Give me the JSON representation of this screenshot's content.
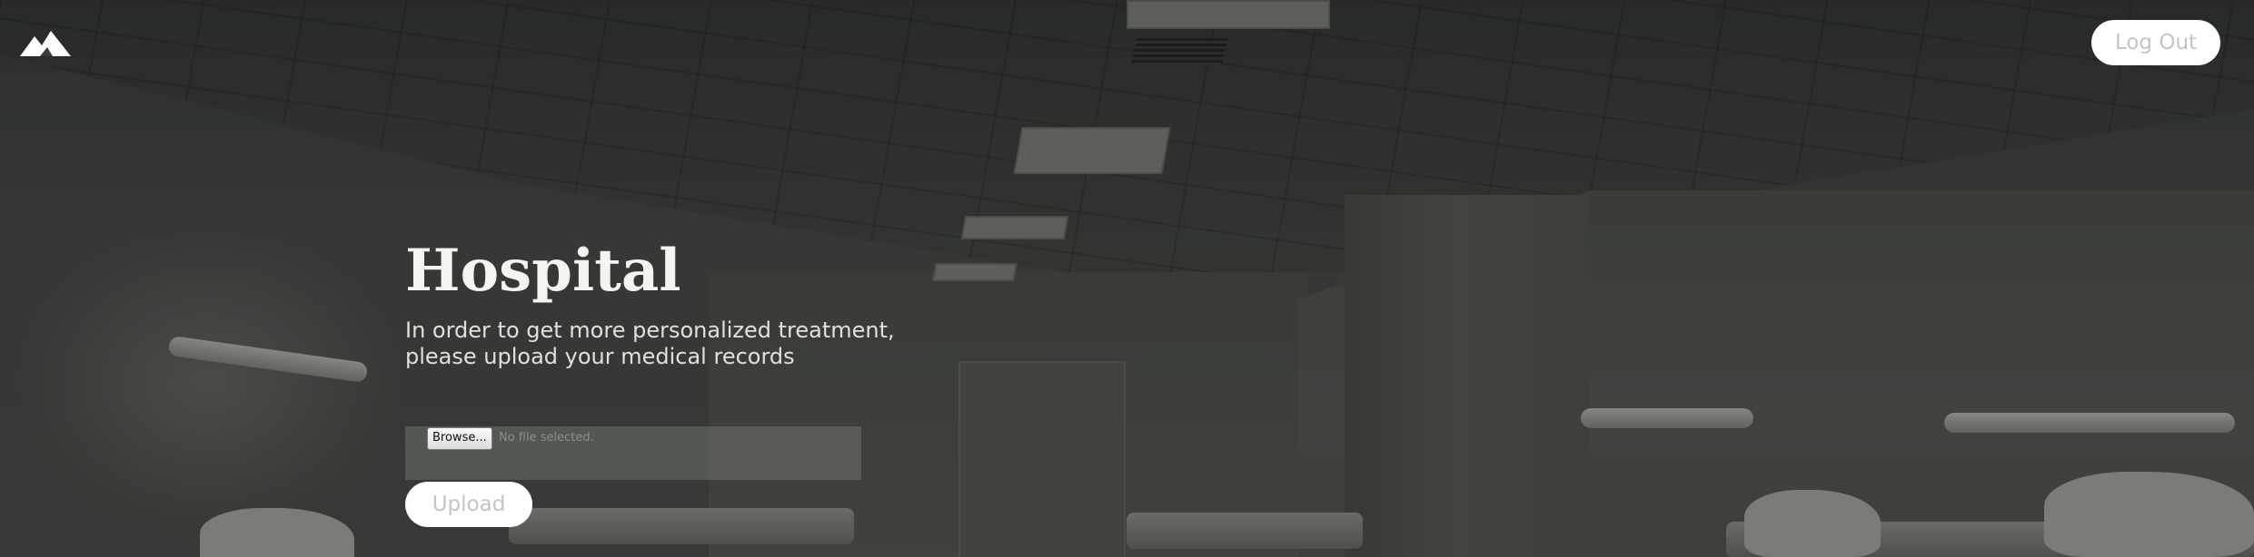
{
  "header": {
    "logo_icon": "mountain-icon",
    "logout_label": "Log Out"
  },
  "hero": {
    "title": "Hospital",
    "subtitle": "In order to get more personalized treatment, please upload your medical records"
  },
  "upload_form": {
    "browse_label": "Browse...",
    "file_status": "No file selected.",
    "upload_label": "Upload"
  },
  "colors": {
    "button_bg": "#ffffff",
    "button_text": "#c4c4c4",
    "title_text": "#f4f4f1"
  }
}
